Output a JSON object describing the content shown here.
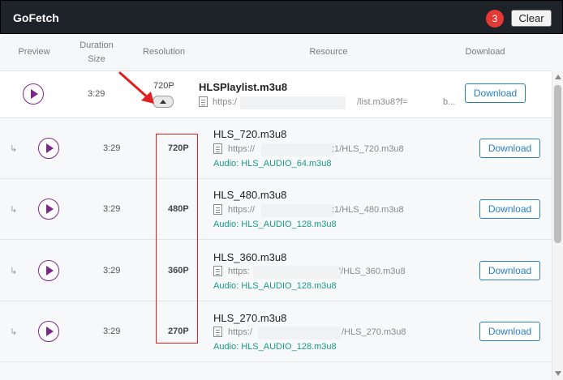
{
  "app": {
    "title": "GoFetch",
    "badge_count": "3",
    "clear_label": "Clear"
  },
  "columns": {
    "preview": "Preview",
    "duration_line1": "Duration",
    "duration_line2": "Size",
    "resolution": "Resolution",
    "resource": "Resource",
    "download": "Download"
  },
  "main_row": {
    "duration": "3:29",
    "resolution": "720P",
    "filename": "HLSPlaylist.m3u8",
    "url_start": "https:/",
    "url_mid": "/list.m3u8?f=",
    "url_end": "b...",
    "download_label": "Download"
  },
  "variants": [
    {
      "duration": "3:29",
      "resolution": "720P",
      "filename": "HLS_720.m3u8",
      "url_start": "https://",
      "url_end": ":1/HLS_720.m3u8",
      "audio": "Audio: HLS_AUDIO_64.m3u8",
      "download_label": "Download"
    },
    {
      "duration": "3:29",
      "resolution": "480P",
      "filename": "HLS_480.m3u8",
      "url_start": "https://",
      "url_end": ":1/HLS_480.m3u8",
      "audio": "Audio: HLS_AUDIO_128.m3u8",
      "download_label": "Download"
    },
    {
      "duration": "3:29",
      "resolution": "360P",
      "filename": "HLS_360.m3u8",
      "url_start": "https:",
      "url_end": "'/HLS_360.m3u8",
      "audio": "Audio: HLS_AUDIO_128.m3u8",
      "download_label": "Download"
    },
    {
      "duration": "3:29",
      "resolution": "270P",
      "filename": "HLS_270.m3u8",
      "url_start": "https:/",
      "url_end": "/HLS_270.m3u8",
      "audio": "Audio: HLS_AUDIO_128.m3u8",
      "download_label": "Download"
    }
  ],
  "colors": {
    "titlebar": "#1e2329",
    "accent_purple": "#7b2a8c",
    "link_blue": "#2a7ec4",
    "audio_teal": "#1a9a8a",
    "annotation_red": "#e02020",
    "badge_red": "#e53935"
  }
}
